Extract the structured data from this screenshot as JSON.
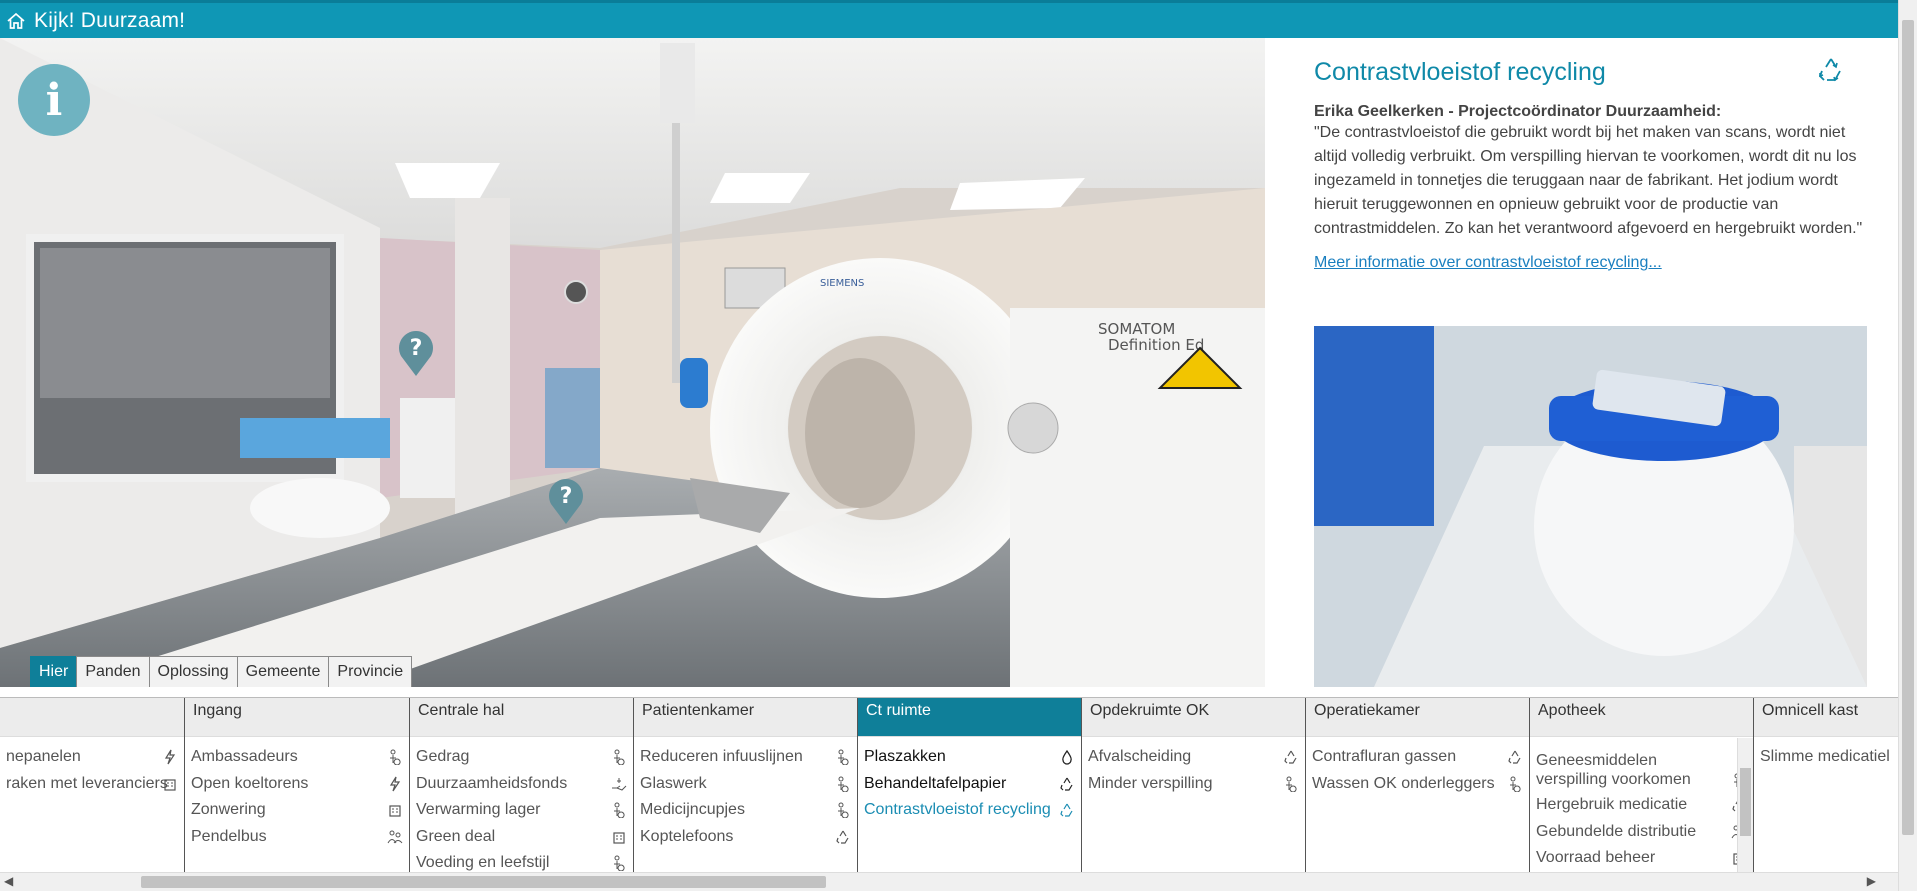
{
  "app": {
    "title": "Kijk! Duurzaam!"
  },
  "scene": {
    "tabs": [
      {
        "label": "Hier",
        "active": true
      },
      {
        "label": "Panden",
        "active": false
      },
      {
        "label": "Oplossing",
        "active": false
      },
      {
        "label": "Gemeente",
        "active": false
      },
      {
        "label": "Provincie",
        "active": false
      }
    ],
    "info_icon": "info-icon",
    "hotspot_icon": "question-marker-icon",
    "scanner_brand": "SIEMENS",
    "scanner_model_line1": "SOMATOM",
    "scanner_model_line2": "Definition Ed"
  },
  "detail": {
    "title": "Contrastvloeistof recycling",
    "icon": "recycle-icon",
    "author": "Erika Geelkerken - Projectcoördinator Duurzaamheid:",
    "quote": "\"De contrastvloeistof die gebruikt wordt bij het maken van scans, wordt niet altijd volledig verbruikt. Om verspilling hiervan te voorkomen, wordt dit nu los ingezameld in tonnetjes die teruggaan naar de fabrikant. Het jodium wordt hieruit teruggewonnen en opnieuw gebruikt voor de productie van contrastmiddelen. Zo kan het verantwoord afgevoerd en hergebruikt worden.\"",
    "link": "Meer informatie over contrastvloeistof recycling..."
  },
  "columns": [
    {
      "head": "",
      "items": [
        {
          "label": "nepanelen",
          "icon": "lightning"
        },
        {
          "label": "raken met leveranciers",
          "icon": "building"
        }
      ]
    },
    {
      "head": "Ingang",
      "items": [
        {
          "label": "Ambassadeurs",
          "icon": "person"
        },
        {
          "label": "Open koeltorens",
          "icon": "lightning"
        },
        {
          "label": "Zonwering",
          "icon": "building"
        },
        {
          "label": "Pendelbus",
          "icon": "people"
        }
      ]
    },
    {
      "head": "Centrale hal",
      "items": [
        {
          "label": "Gedrag",
          "icon": "person"
        },
        {
          "label": "Duurzaamheidsfonds",
          "icon": "hand"
        },
        {
          "label": "Verwarming lager",
          "icon": "person"
        },
        {
          "label": "Green deal",
          "icon": "building"
        },
        {
          "label": "Voeding en leefstijl",
          "icon": "person"
        }
      ]
    },
    {
      "head": "Patientenkamer",
      "items": [
        {
          "label": "Reduceren infuuslijnen",
          "icon": "person"
        },
        {
          "label": "Glaswerk",
          "icon": "person"
        },
        {
          "label": "Medicijncupjes",
          "icon": "person"
        },
        {
          "label": "Koptelefoons",
          "icon": "recycle"
        }
      ]
    },
    {
      "head": "Ct ruimte",
      "active": true,
      "items": [
        {
          "label": "Plaszakken",
          "icon": "drop"
        },
        {
          "label": "Behandeltafelpapier",
          "icon": "recycle"
        },
        {
          "label": "Contrastvloeistof recycling",
          "icon": "recycle",
          "current": true
        }
      ]
    },
    {
      "head": "Opdekruimte OK",
      "items": [
        {
          "label": "Afvalscheiding",
          "icon": "recycle"
        },
        {
          "label": "Minder verspilling",
          "icon": "person"
        }
      ]
    },
    {
      "head": "Operatiekamer",
      "items": [
        {
          "label": "Contrafluran gassen",
          "icon": "recycle"
        },
        {
          "label": "Wassen OK onderleggers",
          "icon": "person"
        }
      ]
    },
    {
      "head": "Apotheek",
      "items": [
        {
          "label": "Geneesmiddelen verspilling voorkomen",
          "icon": "person",
          "multi": true
        },
        {
          "label": "Hergebruik medicatie",
          "icon": "recycle"
        },
        {
          "label": "Gebundelde distributie",
          "icon": "people"
        },
        {
          "label": "Voorraad beheer",
          "icon": "building"
        }
      ]
    },
    {
      "head": "Omnicell kast",
      "items": [
        {
          "label": "Slimme medicatiel",
          "icon": ""
        }
      ]
    }
  ]
}
